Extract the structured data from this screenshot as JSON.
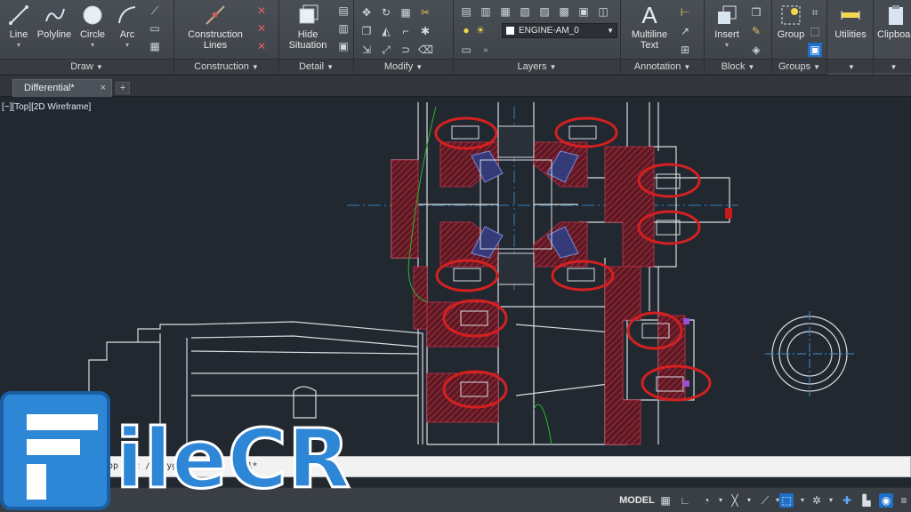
{
  "ribbon": {
    "draw": {
      "title": "Draw",
      "line": "Line",
      "polyline": "Polyline",
      "circle": "Circle",
      "arc": "Arc"
    },
    "construction": {
      "title": "Construction",
      "construction_lines_1": "Construction",
      "construction_lines_2": "Lines"
    },
    "detail": {
      "title": "Detail",
      "hide_situation_1": "Hide",
      "hide_situation_2": "Situation"
    },
    "modify": {
      "title": "Modify"
    },
    "layers": {
      "title": "Layers",
      "current_layer": "ENGINE-AM_0"
    },
    "annotation": {
      "title": "Annotation",
      "multiline_text_1": "Multiline",
      "multiline_text_2": "Text"
    },
    "block": {
      "title": "Block",
      "insert": "Insert"
    },
    "groups": {
      "title": "Groups",
      "group": "Group"
    },
    "utilities": "Utilities",
    "clipboard": "Clipboard"
  },
  "tabs": {
    "document": "Differential*",
    "add": "+"
  },
  "viewport": {
    "label": "[−][Top][2D Wireframe]"
  },
  "command_line": {
    "text": "op   c   c   /Polyg  olygon1: *C   1*"
  },
  "status": {
    "model": "MODEL"
  },
  "watermark": {
    "text": "FileCR"
  },
  "colors": {
    "ribbon_bg": "#3d4248",
    "viewport_bg": "#212830",
    "highlight_circle": "#d42020",
    "hatch": "#b02a3a",
    "accent_blue": "#1e6fc9"
  }
}
